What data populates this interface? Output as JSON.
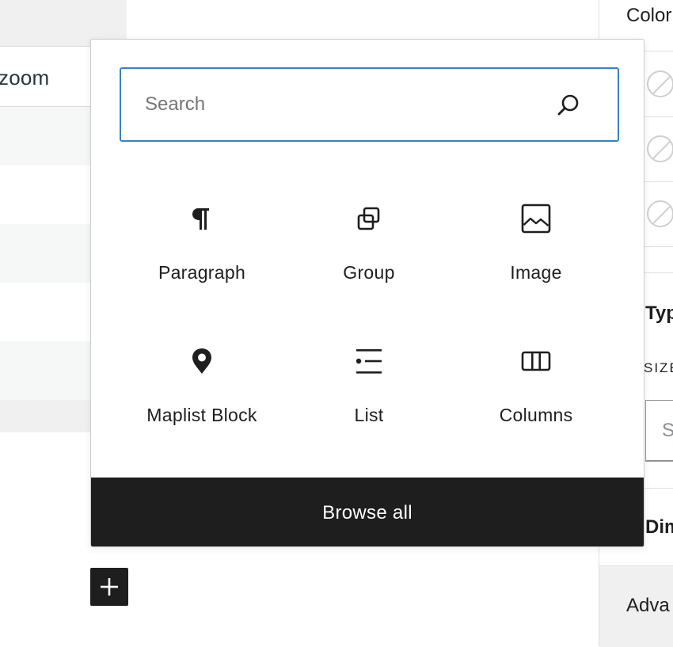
{
  "background_table": {
    "header_text": "zoom"
  },
  "right_sidebar": {
    "color_heading": "Color",
    "typography_heading": "Typo",
    "size_label": "SIZE",
    "size_input_text": "S",
    "dimensions_heading": "Dime",
    "advanced_heading": "Adva"
  },
  "inserter": {
    "search": {
      "placeholder": "Search",
      "value": ""
    },
    "blocks": [
      {
        "label": "Paragraph",
        "icon": "paragraph-icon"
      },
      {
        "label": "Group",
        "icon": "group-icon"
      },
      {
        "label": "Image",
        "icon": "image-icon"
      },
      {
        "label": "Maplist Block",
        "icon": "map-pin-icon"
      },
      {
        "label": "List",
        "icon": "list-icon"
      },
      {
        "label": "Columns",
        "icon": "columns-icon"
      }
    ],
    "browse_all_label": "Browse all"
  },
  "add_block_button": {
    "icon": "plus-icon"
  }
}
